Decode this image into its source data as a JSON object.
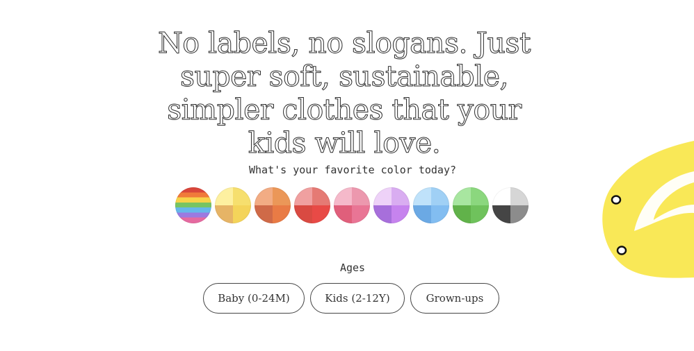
{
  "hero": {
    "headline": "No labels, no slogans. Just super soft, sustainable, simpler clothes that your kids will love."
  },
  "colors": {
    "question": "What's your favorite color today?",
    "swatches": [
      {
        "name": "rainbow",
        "quadrants": [
          "#d9453a",
          "#f7d34a",
          "#66b7ea",
          "#9b7ae0"
        ]
      },
      {
        "name": "yellow",
        "quadrants": [
          "#fdf0a0",
          "#f6df6e",
          "#e6b466",
          "#f4d45a"
        ]
      },
      {
        "name": "orange",
        "quadrants": [
          "#f2ac84",
          "#eb9758",
          "#cf6a48",
          "#e97b45"
        ]
      },
      {
        "name": "red",
        "quadrants": [
          "#f0a0a0",
          "#e57a74",
          "#d94a42",
          "#e84a46"
        ]
      },
      {
        "name": "pink",
        "quadrants": [
          "#f5b9ca",
          "#ec98ae",
          "#e05f7b",
          "#e97595"
        ]
      },
      {
        "name": "purple",
        "quadrants": [
          "#eed2f8",
          "#d9adf1",
          "#a76fdb",
          "#c683ee"
        ]
      },
      {
        "name": "blue",
        "quadrants": [
          "#bfe2fa",
          "#a0d0f5",
          "#6ba9e4",
          "#82bdf1"
        ]
      },
      {
        "name": "green",
        "quadrants": [
          "#a8e6a0",
          "#8bd77e",
          "#61b24a",
          "#6fc25c"
        ]
      },
      {
        "name": "grayscale",
        "quadrants": [
          "#ffffff",
          "#d6d6d6",
          "#454545",
          "#8c8c8c"
        ]
      }
    ]
  },
  "ages": {
    "label": "Ages",
    "options": [
      "Baby (0-24M)",
      "Kids (2-12Y)",
      "Grown-ups"
    ]
  },
  "mascot": {
    "color": "#f9e857"
  }
}
